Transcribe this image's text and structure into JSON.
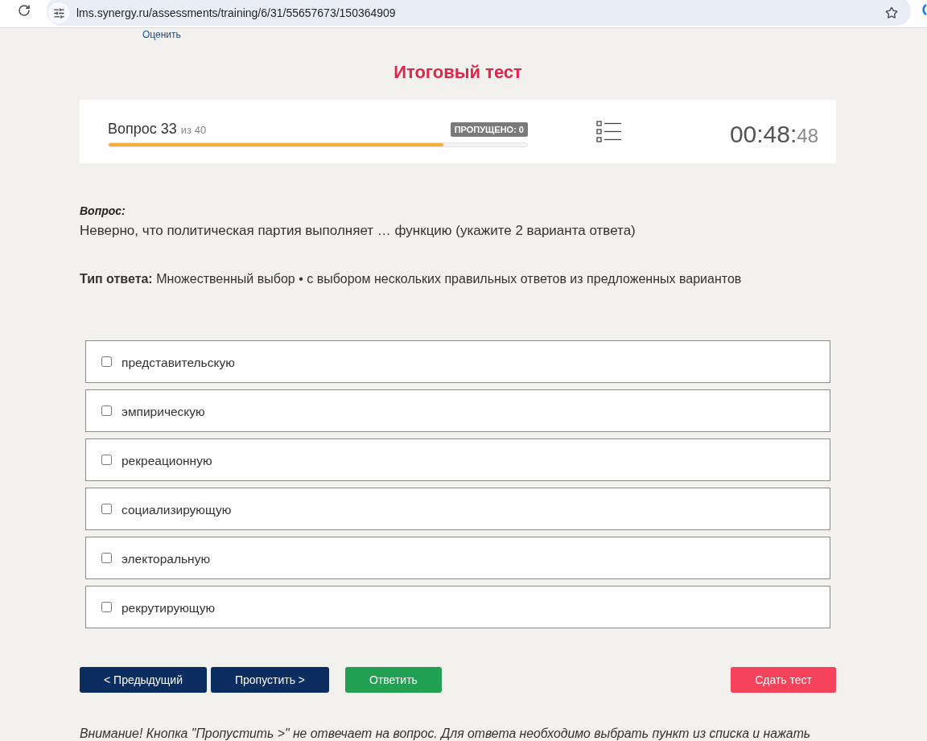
{
  "browser": {
    "url": "lms.synergy.ru/assessments/training/6/31/55657673/150364909"
  },
  "header_link": "Оценить",
  "title": "Итоговый тест",
  "progress": {
    "counter": "Вопрос 33",
    "total": "из 40",
    "skipped_badge": "ПРОПУЩЕНО: 0",
    "level": 0.8,
    "timer": {
      "hours_minutes": "00:48:",
      "seconds": "48"
    }
  },
  "question": {
    "label": "Вопрос:",
    "text": "Неверно, что политическая партия выполняет … функцию (укажите 2 варианта ответа)",
    "answer_type": "**Тип ответа:** Множественный выбор • с выбором нескольких правильных ответов из предложенных вариантов"
  },
  "options": [
    {
      "label": "представительскую",
      "checked": false
    },
    {
      "label": "эмпирическую",
      "checked": false
    },
    {
      "label": "рекреационную",
      "checked": false
    },
    {
      "label": "социализирующую",
      "checked": false
    },
    {
      "label": "электоральную",
      "checked": false
    },
    {
      "label": "рекрутирующую",
      "checked": false
    }
  ],
  "buttons": [
    {
      "label": "< Предыдущий",
      "kind": "nav"
    },
    {
      "label": "Пропустить >",
      "kind": "nav"
    },
    {
      "label": "Ответить",
      "kind": "answer"
    },
    {
      "label": "Сдать тест",
      "kind": "finish"
    }
  ],
  "notice": "Внимание! Кнопка \"Пропустить >\" не отвечает на вопрос. Для ответа необходимо выбрать пункт из списка и нажать"
}
